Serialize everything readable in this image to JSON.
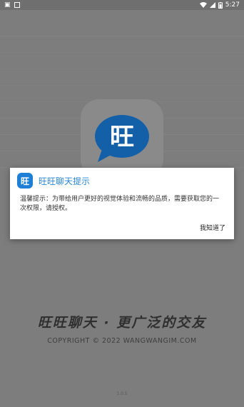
{
  "status_bar": {
    "time": "5:27"
  },
  "dialog": {
    "icon_glyph": "旺",
    "title": "旺旺聊天提示",
    "message": "温馨提示：为带给用户更好的视觉体验和流畅的品质，需要获取您的一次权限，请授权。",
    "confirm_label": "我知道了"
  },
  "splash": {
    "logo_glyph": "旺",
    "slogan": "旺旺聊天 · 更广泛的交友",
    "copyright": "COPYRIGHT © 2022 WANGWANGIM.COM",
    "version": "1.0.5"
  },
  "colors": {
    "brand_blue": "#1e7fd6",
    "title_blue": "#2a86d8"
  }
}
